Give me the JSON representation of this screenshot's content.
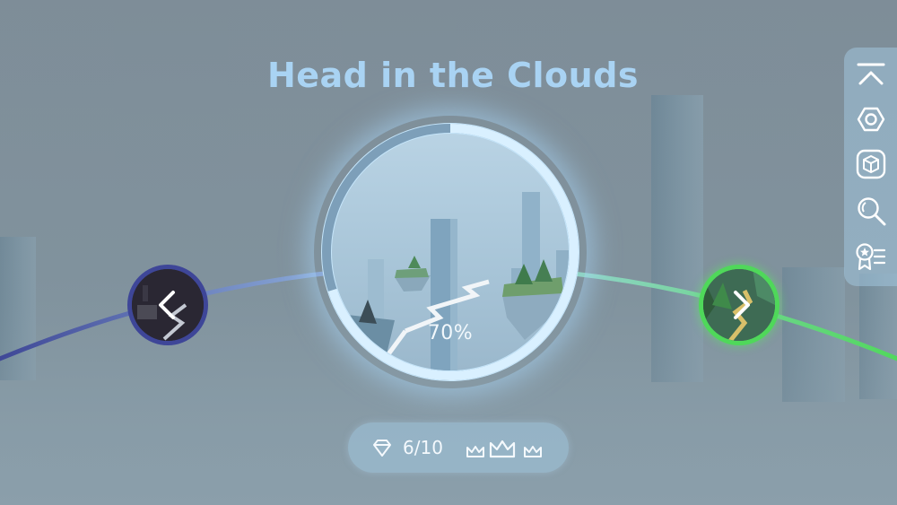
{
  "level": {
    "title": "Head in the Clouds",
    "progress_text": "70%",
    "progress": 0.7
  },
  "stats": {
    "gems_text": "6/10",
    "gem_icon": "diamond-icon",
    "crowns_icon": "crown-icon",
    "crown_count": 3
  },
  "navigation": {
    "previous_icon": "chevron-left-icon",
    "next_icon": "chevron-right-icon"
  },
  "side_menu": {
    "items": [
      {
        "icon": "collapse-up-icon"
      },
      {
        "icon": "settings-hexagon-icon"
      },
      {
        "icon": "cube-icon"
      },
      {
        "icon": "search-icon"
      },
      {
        "icon": "achievements-icon"
      }
    ]
  },
  "colors": {
    "title": "#a9d3f3",
    "track_left": "#3d4595",
    "track_center": "#a9d1f2",
    "track_right": "#4fd85a",
    "previous_ring": "#3e4698",
    "next_ring": "#4fd85a"
  }
}
